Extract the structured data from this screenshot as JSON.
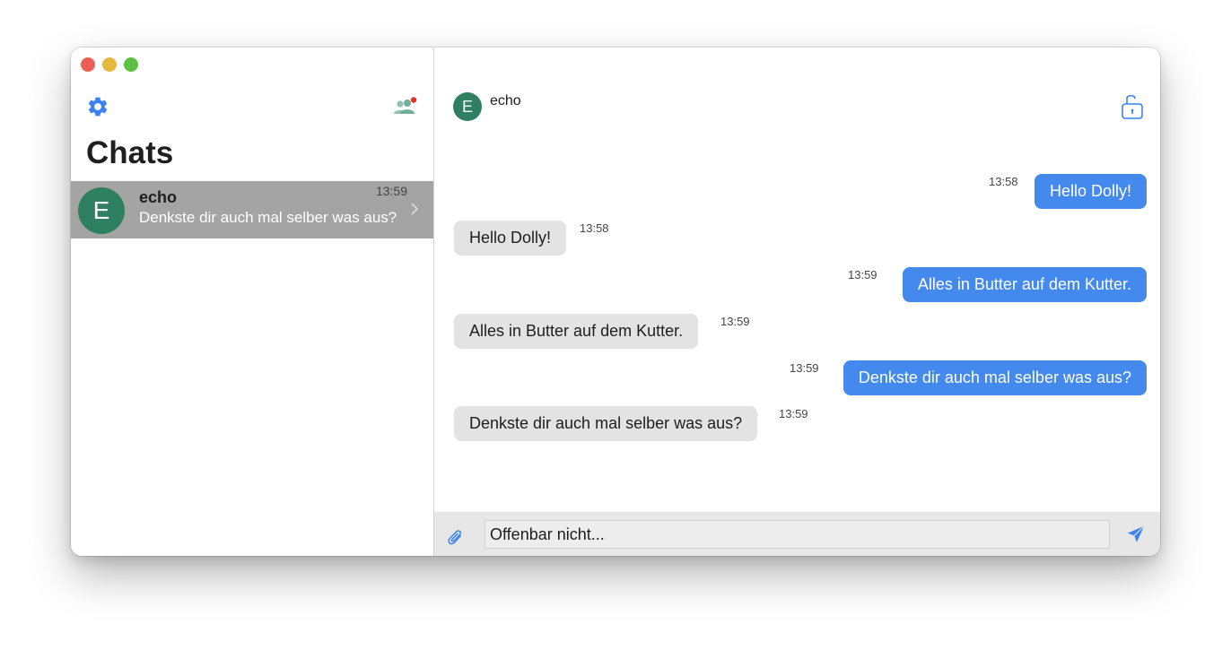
{
  "sidebar": {
    "title": "Chats",
    "chats": [
      {
        "avatar_letter": "E",
        "name": "echo",
        "time": "13:59",
        "preview": "Denkste dir auch mal selber was aus?"
      }
    ]
  },
  "conversation": {
    "contact_letter": "E",
    "contact_name": "echo",
    "messages": [
      {
        "direction": "out",
        "time": "13:58",
        "text": "Hello Dolly!"
      },
      {
        "direction": "in",
        "time": "13:58",
        "text": "Hello Dolly!"
      },
      {
        "direction": "out",
        "time": "13:59",
        "text": "Alles in Butter auf dem Kutter."
      },
      {
        "direction": "in",
        "time": "13:59",
        "text": "Alles in Butter auf dem Kutter."
      },
      {
        "direction": "out",
        "time": "13:59",
        "text": "Denkste dir auch mal selber was aus?"
      },
      {
        "direction": "in",
        "time": "13:59",
        "text": "Denkste dir auch mal selber was aus?"
      }
    ]
  },
  "composer": {
    "value": "Offenbar nicht..."
  },
  "icons": {
    "settings": "gear-icon",
    "contacts": "contacts-icon",
    "encryption": "lock-open-icon",
    "attach": "paperclip-icon",
    "send": "send-icon"
  },
  "colors": {
    "accent": "#4389ee",
    "avatar": "#2f7f63",
    "selected_row": "#a4a4a4",
    "incoming_bubble": "#e3e3e3",
    "notification_dot": "#e0322b"
  }
}
